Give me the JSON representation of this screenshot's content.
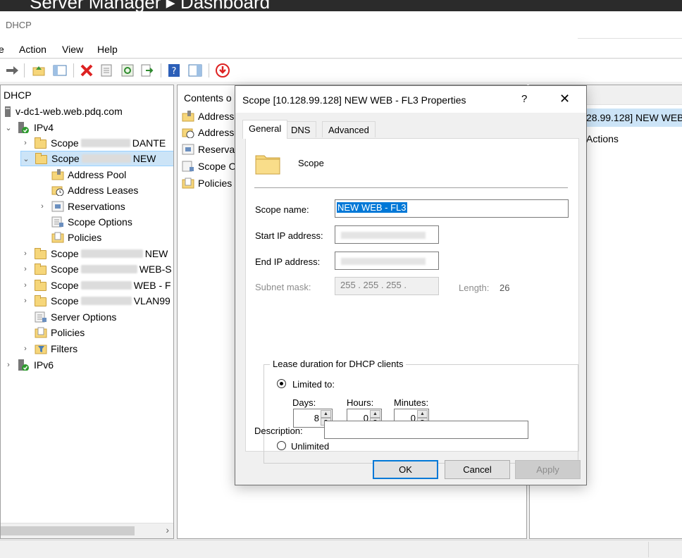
{
  "window": {
    "top_title": "Server Manager ▸ Dashboard",
    "app_title": "DHCP"
  },
  "menu": [
    "e",
    "Action",
    "View",
    "Help"
  ],
  "tree": {
    "root": "DHCP",
    "server": "v-dc1-web.web.pdq.com",
    "ipv4": "IPv4",
    "scopes": [
      {
        "label": "Scope",
        "suffix": "DANTE"
      },
      {
        "label": "Scope",
        "suffix": "NEW"
      },
      {
        "label": "Scope",
        "suffix": "NEW"
      },
      {
        "label": "Scope",
        "suffix": "WEB-S"
      },
      {
        "label": "Scope",
        "suffix": "WEB - F"
      },
      {
        "label": "Scope",
        "suffix": "VLAN99"
      }
    ],
    "scope_children": [
      "Address Pool",
      "Address Leases",
      "Reservations",
      "Scope Options",
      "Policies"
    ],
    "ipv4_items": [
      "Server Options",
      "Policies",
      "Filters"
    ],
    "ipv6": "IPv6"
  },
  "content": {
    "header": "Contents o",
    "items": [
      "Address",
      "Address",
      "Reservat",
      "Scope O",
      "Policies"
    ]
  },
  "actions": {
    "selected": "28.99.128] NEW WEB",
    "more": "Actions"
  },
  "dialog": {
    "title": "Scope [10.128.99.128] NEW WEB - FL3 Properties",
    "help": "?",
    "close": "✕",
    "tabs": [
      "General",
      "DNS",
      "Advanced"
    ],
    "scope_heading": "Scope",
    "scope_name_label": "Scope name:",
    "scope_name_value": "NEW WEB - FL3",
    "start_ip_label": "Start IP address:",
    "end_ip_label": "End IP address:",
    "subnet_label": "Subnet mask:",
    "subnet_value": "255 . 255 . 255 .",
    "length_label": "Length:",
    "length_value": "26",
    "lease_group": "Lease duration for DHCP clients",
    "limited_label": "Limited to:",
    "days_label": "Days:",
    "hours_label": "Hours:",
    "minutes_label": "Minutes:",
    "days_value": "8",
    "hours_value": "0",
    "minutes_value": "0",
    "unlimited_label": "Unlimited",
    "description_label": "Description:",
    "description_value": "",
    "ok": "OK",
    "cancel": "Cancel",
    "apply": "Apply"
  }
}
